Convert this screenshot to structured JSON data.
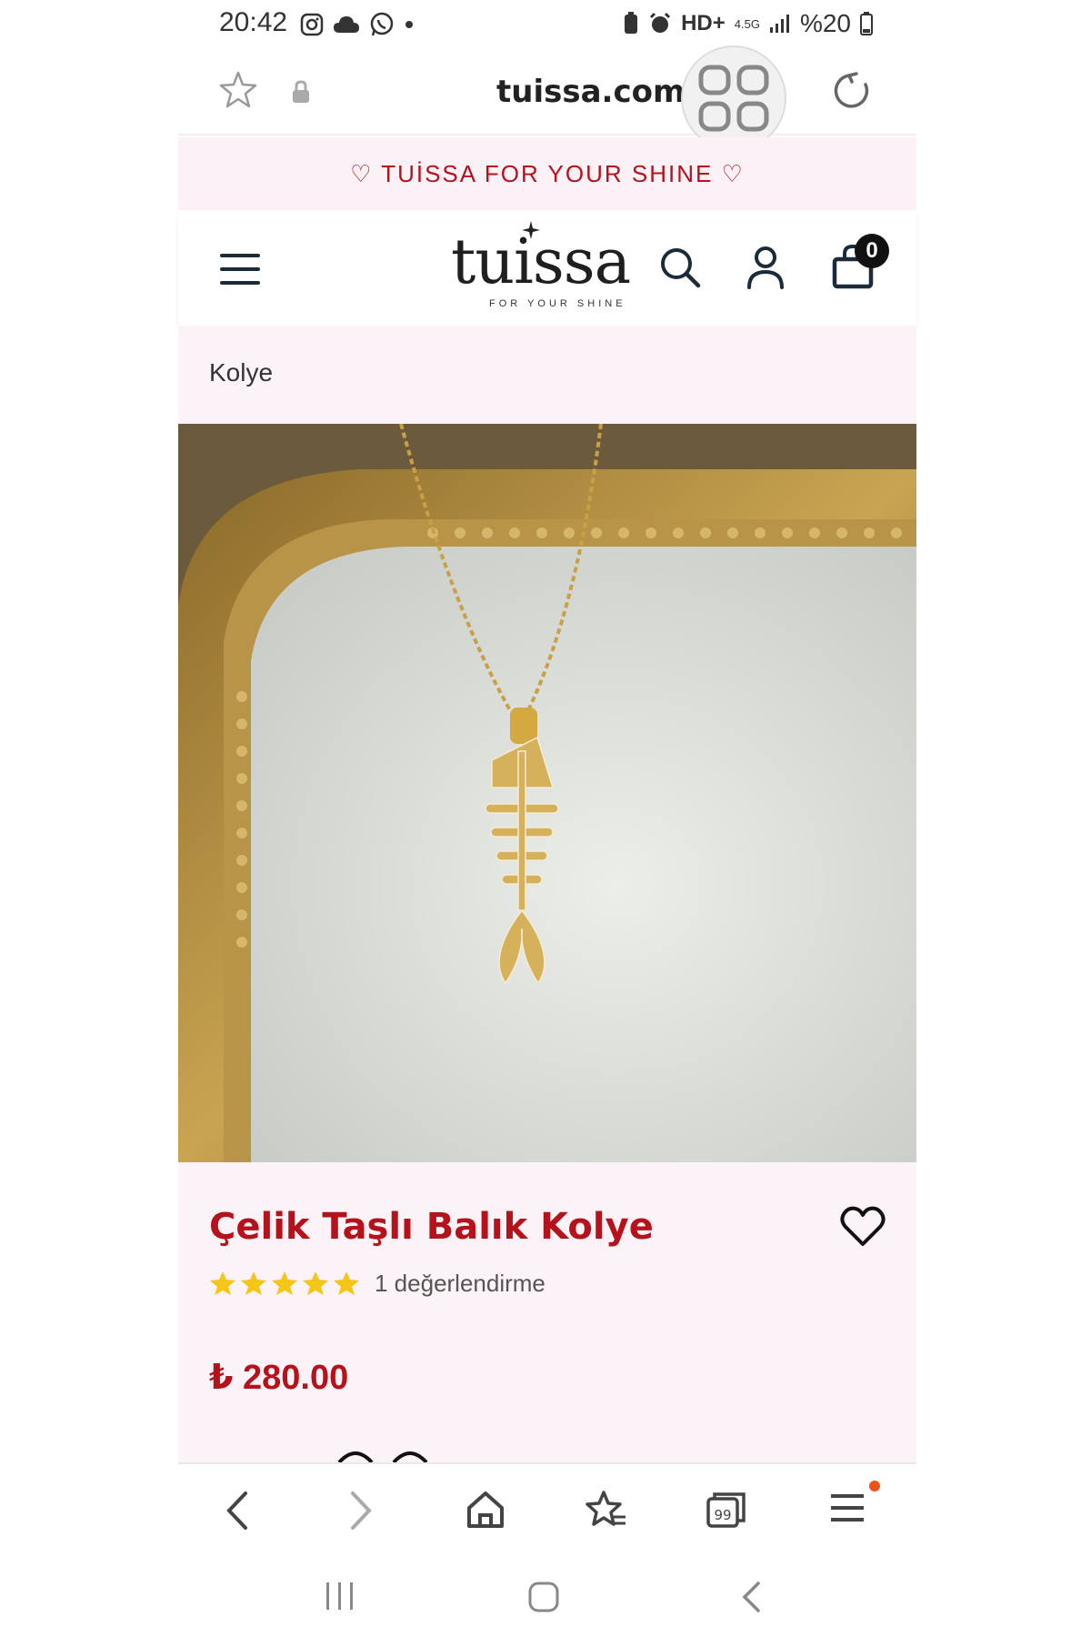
{
  "status_bar": {
    "time": "20:42",
    "left_icons": [
      "instagram-icon",
      "cloud-icon",
      "whatsapp-icon",
      "dot-icon"
    ],
    "right_icons": [
      "battery-saver-icon",
      "alarm-icon"
    ],
    "network": "HD+",
    "network_type": "4.5G",
    "battery": "%20"
  },
  "browser": {
    "url": "tuissa.com",
    "tab_icon": "tabs-grid-icon"
  },
  "announcement": "♡ TUİSSA FOR YOUR SHINE ♡",
  "header": {
    "logo_text": "tuissa",
    "logo_tagline": "FOR YOUR SHINE",
    "cart_count": "0"
  },
  "breadcrumb": "Kolye",
  "product": {
    "title": "Çelik Taşlı Balık Kolye",
    "rating_stars": 5,
    "rating_text": "1 değerlendirme",
    "price": "₺ 280.00"
  },
  "colors": {
    "accent": "#b5121b",
    "announce_bg": "#fcf1f7",
    "section_bg": "#fcf3f8",
    "star": "#f5c518"
  }
}
